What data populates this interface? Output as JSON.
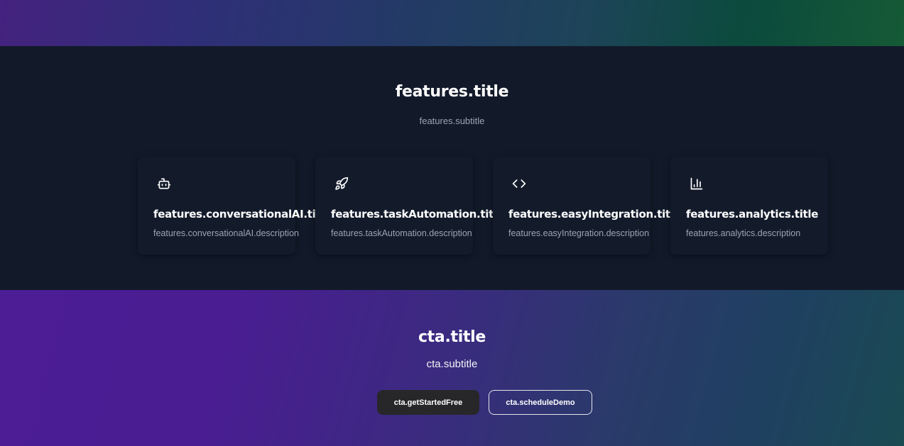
{
  "features": {
    "title": "features.title",
    "subtitle": "features.subtitle",
    "cards": [
      {
        "icon": "bot-icon",
        "title": "features.conversationalAI.title",
        "description": "features.conversationalAI.description"
      },
      {
        "icon": "rocket-icon",
        "title": "features.taskAutomation.title",
        "description": "features.taskAutomation.description"
      },
      {
        "icon": "code-icon",
        "title": "features.easyIntegration.title",
        "description": "features.easyIntegration.description"
      },
      {
        "icon": "bar-chart-icon",
        "title": "features.analytics.title",
        "description": "features.analytics.description"
      }
    ]
  },
  "cta": {
    "title": "cta.title",
    "subtitle": "cta.subtitle",
    "primary_label": "cta.getStartedFree",
    "secondary_label": "cta.scheduleDemo"
  },
  "colors": {
    "features_bg": "#121a2a",
    "text_muted": "#9ca3af",
    "primary_button_bg": "#27272a",
    "cta_gradient_start": "#4c1d95",
    "cta_gradient_end": "#1a4a52"
  }
}
